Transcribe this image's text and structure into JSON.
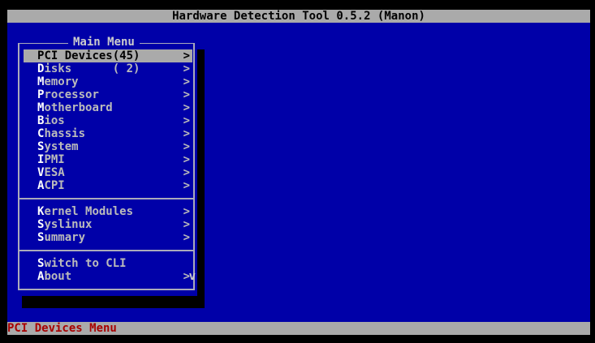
{
  "title": "Hardware Detection Tool 0.5.2 (Manon)",
  "menu": {
    "title": "Main Menu",
    "groups": [
      [
        {
          "hk": "P",
          "rest": "CI Devices(45)",
          "arrow": ">"
        },
        {
          "hk": "D",
          "rest": "isks      ( 2)",
          "arrow": ">"
        },
        {
          "hk": "M",
          "rest": "emory",
          "arrow": ">"
        },
        {
          "hk": "P",
          "rest": "rocessor",
          "arrow": ">"
        },
        {
          "hk": "M",
          "rest": "otherboard",
          "arrow": ">"
        },
        {
          "hk": "B",
          "rest": "ios",
          "arrow": ">"
        },
        {
          "hk": "C",
          "rest": "hassis",
          "arrow": ">"
        },
        {
          "hk": "S",
          "rest": "ystem",
          "arrow": ">"
        },
        {
          "hk": "I",
          "rest": "PMI",
          "arrow": ">"
        },
        {
          "hk": "V",
          "rest": "ESA",
          "arrow": ">"
        },
        {
          "hk": "A",
          "rest": "CPI",
          "arrow": ">"
        }
      ],
      [
        {
          "hk": "K",
          "rest": "ernel Modules",
          "arrow": ">"
        },
        {
          "hk": "S",
          "rest": "yslinux",
          "arrow": ">"
        },
        {
          "hk": "S",
          "rest": "ummary",
          "arrow": ">"
        }
      ],
      [
        {
          "hk": "S",
          "rest": "witch to CLI",
          "arrow": ""
        },
        {
          "hk": "A",
          "rest": "bout",
          "arrow": ">"
        }
      ]
    ],
    "scroll_indicator": "v"
  },
  "status": "PCI Devices Menu"
}
